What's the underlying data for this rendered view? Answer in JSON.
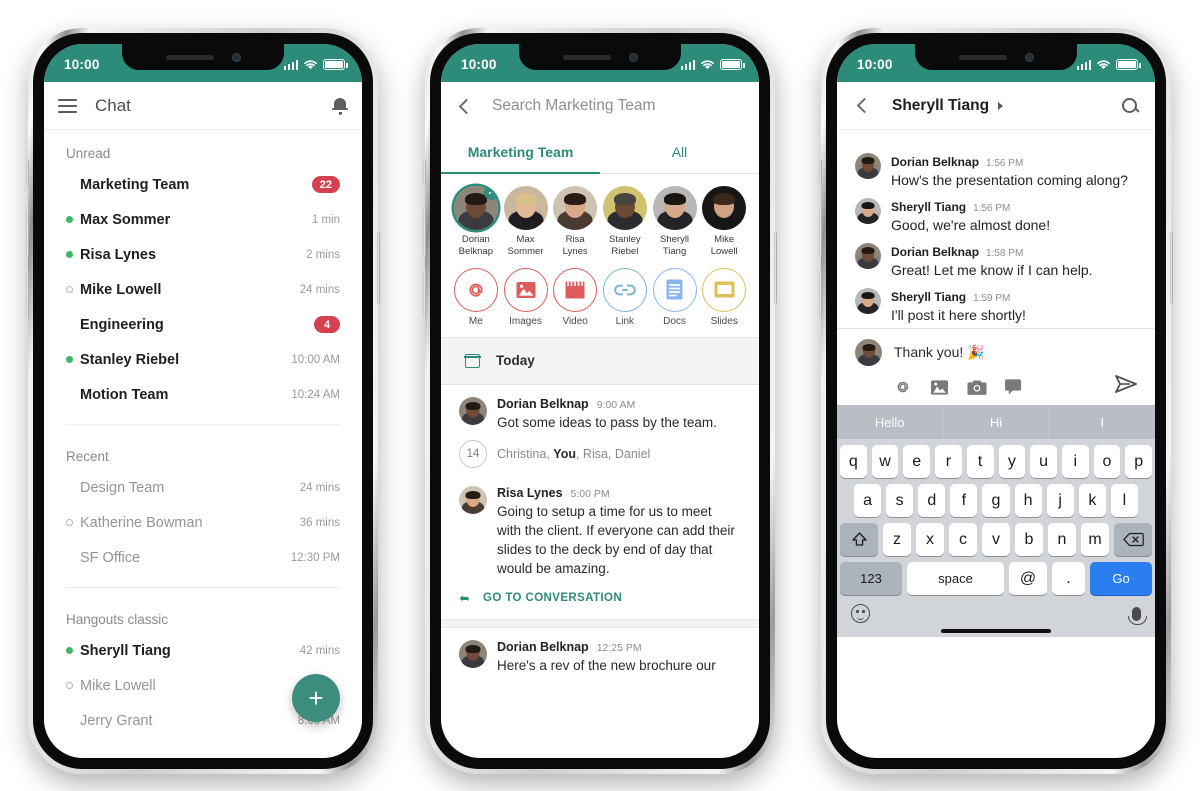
{
  "status_bar": {
    "time": "10:00",
    "signal_icon": "cellular-bars-icon",
    "wifi_icon": "wifi-icon",
    "battery_icon": "battery-full-icon"
  },
  "colors": {
    "brand_teal": "#2c8b79",
    "fab_teal": "#3c8d7d",
    "badge_red": "#d6414f",
    "online_green": "#3fb568",
    "keyboard_blue": "#2a7ef0"
  },
  "phone1": {
    "appbar": {
      "menu_icon": "hamburger-menu-icon",
      "title": "Chat",
      "notification_icon": "bell-icon"
    },
    "fab_label": "+",
    "sections": [
      {
        "label": "Unread",
        "rows": [
          {
            "name": "Marketing Team",
            "meta": "22",
            "meta_type": "badge",
            "presence": "none",
            "unread": true
          },
          {
            "name": "Max Sommer",
            "meta": "1 min",
            "meta_type": "time",
            "presence": "online",
            "unread": true
          },
          {
            "name": "Risa Lynes",
            "meta": "2 mins",
            "meta_type": "time",
            "presence": "online",
            "unread": true
          },
          {
            "name": "Mike Lowell",
            "meta": "24 mins",
            "meta_type": "time",
            "presence": "away",
            "unread": true
          },
          {
            "name": "Engineering",
            "meta": "4",
            "meta_type": "badge",
            "presence": "none",
            "unread": true
          },
          {
            "name": "Stanley Riebel",
            "meta": "10:00 AM",
            "meta_type": "time",
            "presence": "online",
            "unread": true
          },
          {
            "name": "Motion Team",
            "meta": "10:24 AM",
            "meta_type": "time",
            "presence": "none",
            "unread": true
          }
        ]
      },
      {
        "label": "Recent",
        "rows": [
          {
            "name": "Design Team",
            "meta": "24 mins",
            "meta_type": "time",
            "presence": "none",
            "unread": false
          },
          {
            "name": "Katherine Bowman",
            "meta": "36 mins",
            "meta_type": "time",
            "presence": "away",
            "unread": false
          },
          {
            "name": "SF Office",
            "meta": "12:30 PM",
            "meta_type": "time",
            "presence": "none",
            "unread": false
          }
        ]
      },
      {
        "label": "Hangouts classic",
        "rows": [
          {
            "name": "Sheryll Tiang",
            "meta": "42 mins",
            "meta_type": "time",
            "presence": "online",
            "unread": true
          },
          {
            "name": "Mike Lowell",
            "meta": "",
            "meta_type": "time",
            "presence": "away",
            "unread": false
          },
          {
            "name": "Jerry Grant",
            "meta": "8:00 AM",
            "meta_type": "time",
            "presence": "none",
            "unread": false
          }
        ]
      }
    ]
  },
  "phone2": {
    "back_icon": "chevron-left-icon",
    "search_placeholder": "Search Marketing Team",
    "tabs": [
      {
        "label": "Marketing Team",
        "active": true
      },
      {
        "label": "All",
        "active": false
      }
    ],
    "people": [
      {
        "name_line1": "Dorian",
        "name_line2": "Belknap",
        "selected": true
      },
      {
        "name_line1": "Max",
        "name_line2": "Sommer",
        "selected": false
      },
      {
        "name_line1": "Risa",
        "name_line2": "Lynes",
        "selected": false
      },
      {
        "name_line1": "Stanley",
        "name_line2": "Riebel",
        "selected": false
      },
      {
        "name_line1": "Sheryll",
        "name_line2": "Tiang",
        "selected": false
      },
      {
        "name_line1": "Mike",
        "name_line2": "Lowell",
        "selected": false
      }
    ],
    "filters": [
      {
        "label": "Me",
        "icon": "at-mention-icon",
        "color": "#de5c5c"
      },
      {
        "label": "Images",
        "icon": "image-icon",
        "color": "#de5c5c"
      },
      {
        "label": "Video",
        "icon": "video-clapper-icon",
        "color": "#de5c5c"
      },
      {
        "label": "Link",
        "icon": "link-chain-icon",
        "color": "#7fb6cf"
      },
      {
        "label": "Docs",
        "icon": "docs-file-icon",
        "color": "#8ab4f0"
      },
      {
        "label": "Slides",
        "icon": "slides-file-icon",
        "color": "#dcc159"
      }
    ],
    "day_divider": {
      "icon": "calendar-icon",
      "label": "Today"
    },
    "results": [
      {
        "type": "message",
        "name": "Dorian Belknap",
        "time": "9:00 AM",
        "text": "Got some ideas to pass by the team."
      },
      {
        "type": "group",
        "count": "14",
        "prefix": "Christina, ",
        "bold": "You",
        "suffix": ", Risa, Daniel"
      },
      {
        "type": "message",
        "name": "Risa Lynes",
        "time": "5:00 PM",
        "text": "Going to setup a time for us to meet with the client. If everyone can add their slides to the deck by end of day that would be amazing."
      },
      {
        "type": "action",
        "icon": "reply-arrow-icon",
        "label": "GO TO CONVERSATION"
      },
      {
        "type": "message",
        "name": "Dorian Belknap",
        "time": "12:25 PM",
        "text": "Here's a rev of the new brochure our"
      }
    ]
  },
  "phone3": {
    "back_icon": "chevron-left-icon",
    "title": "Sheryll Tiang",
    "title_caret_icon": "caret-right-icon",
    "search_icon": "search-icon",
    "messages": [
      {
        "name": "Dorian Belknap",
        "time": "1:56 PM",
        "text": "How's the presentation coming along?"
      },
      {
        "name": "Sheryll Tiang",
        "time": "1:56 PM",
        "text": "Good, we're almost done!"
      },
      {
        "name": "Dorian Belknap",
        "time": "1:58 PM",
        "text": "Great! Let me know if I can help."
      },
      {
        "name": "Sheryll Tiang",
        "time": "1:59 PM",
        "text": "I'll post it here shortly!"
      }
    ],
    "composer": {
      "value": "Thank you! 🎉",
      "icons": [
        {
          "icon": "at-mention-icon"
        },
        {
          "icon": "image-icon"
        },
        {
          "icon": "camera-icon"
        },
        {
          "icon": "sticker-chat-icon"
        }
      ],
      "send_icon": "send-icon"
    },
    "keyboard": {
      "predictions": [
        "Hello",
        "Hi",
        "I"
      ],
      "row1": [
        "q",
        "w",
        "e",
        "r",
        "t",
        "y",
        "u",
        "i",
        "o",
        "p"
      ],
      "row2": [
        "a",
        "s",
        "d",
        "f",
        "g",
        "h",
        "j",
        "k",
        "l"
      ],
      "row3_shift_icon": "shift-up-icon",
      "row3": [
        "z",
        "x",
        "c",
        "v",
        "b",
        "n",
        "m"
      ],
      "row3_backspace_icon": "backspace-icon",
      "numeric_label": "123",
      "space_label": "space",
      "at_label": "@",
      "dot_label": ".",
      "go_label": "Go",
      "emoji_icon": "emoji-smiley-icon",
      "mic_icon": "microphone-icon"
    }
  }
}
